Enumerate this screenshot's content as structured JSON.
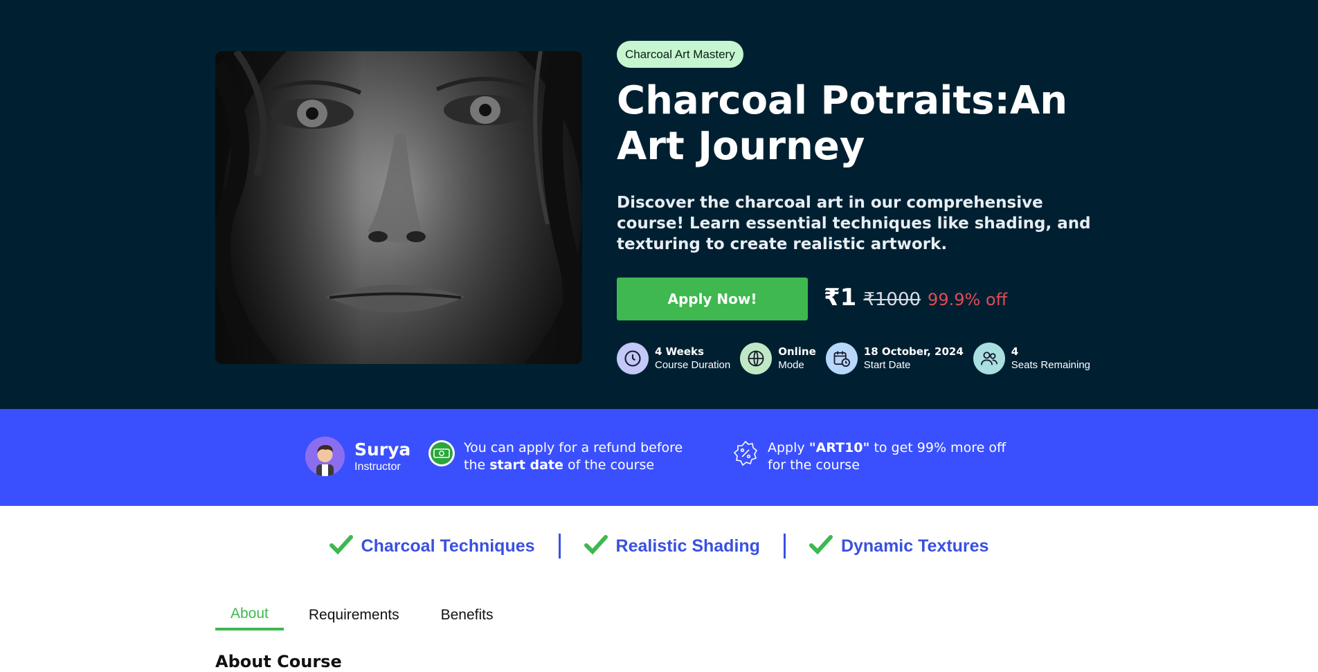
{
  "hero": {
    "category": "Charcoal Art Mastery",
    "title": "Charcoal Potraits:An Art Journey",
    "description": "Discover the charcoal art in our comprehensive course! Learn essential techniques like shading, and texturing to create realistic artwork.",
    "apply_label": "Apply Now!",
    "price_current": "₹1",
    "price_original": "₹1000",
    "price_discount": "99.9% off",
    "info": [
      {
        "value": "4 Weeks",
        "label": "Course Duration",
        "icon": "clock-icon",
        "icon_bg": "#c3c8f8"
      },
      {
        "value": "Online",
        "label": "Mode",
        "icon": "globe-icon",
        "icon_bg": "#bfe8c4"
      },
      {
        "value": "18 October, 2024",
        "label": "Start Date",
        "icon": "calendar-clock-icon",
        "icon_bg": "#b8d8fb"
      },
      {
        "value": "4",
        "label": "Seats Remaining",
        "icon": "users-icon",
        "icon_bg": "#a9dfe0"
      }
    ]
  },
  "band": {
    "instructor_name": "Surya",
    "instructor_role": "Instructor",
    "refund_text_1": "You can apply for a refund before the",
    "refund_bold": "start date",
    "refund_text_2": "of the course",
    "promo_text_1": "Apply",
    "promo_code": "\"ART10\"",
    "promo_text_2": "to get 99% more off for the course"
  },
  "highlights": [
    {
      "label": "Charcoal Techniques"
    },
    {
      "label": "Realistic Shading"
    },
    {
      "label": "Dynamic Textures"
    }
  ],
  "tabs": [
    {
      "label": "About",
      "active": true
    },
    {
      "label": "Requirements",
      "active": false
    },
    {
      "label": "Benefits",
      "active": false
    }
  ],
  "about_heading": "About Course",
  "colors": {
    "hero_bg": "#002032",
    "band_bg": "#3a50ff",
    "accent_green": "#3eb84f",
    "accent_blue": "#3a50e0",
    "discount_red": "#e04b57"
  }
}
